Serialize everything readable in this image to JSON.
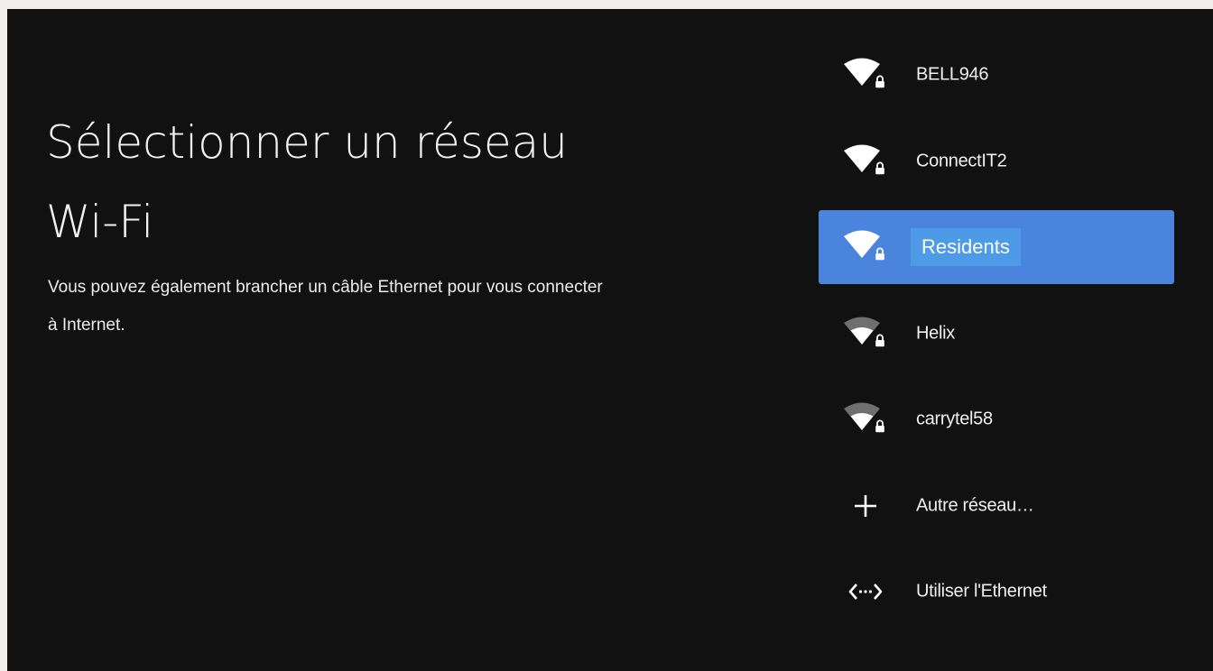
{
  "page": {
    "title_line1": "Sélectionner un réseau",
    "title_line2": "Wi-Fi",
    "subtitle_line1": "Vous pouvez également brancher un câble Ethernet pour vous connecter",
    "subtitle_line2": "à Internet."
  },
  "networks": [
    {
      "label": "BELL946",
      "icon": "wifi-locked-full-icon",
      "signal_bars": 4,
      "secured": true
    },
    {
      "label": "ConnectIT2",
      "icon": "wifi-locked-full-icon",
      "signal_bars": 4,
      "secured": true
    },
    {
      "label": "Residents",
      "icon": "wifi-locked-full-icon",
      "signal_bars": 4,
      "secured": true,
      "selected": true
    },
    {
      "label": "Helix",
      "icon": "wifi-locked-partial-icon",
      "signal_bars": 2,
      "secured": true
    },
    {
      "label": "carrytel58",
      "icon": "wifi-locked-partial-icon",
      "signal_bars": 2,
      "secured": true
    }
  ],
  "actions": [
    {
      "label": "Autre réseau…",
      "icon": "plus-icon"
    },
    {
      "label": "Utiliser l'Ethernet",
      "icon": "ethernet-icon"
    }
  ],
  "colors": {
    "background": "#111111",
    "selected_row": "#4a84dd",
    "selected_label_highlight": "#4d9ae6",
    "text": "#f0f0f0",
    "weak_signal": "#6f6f6f"
  }
}
